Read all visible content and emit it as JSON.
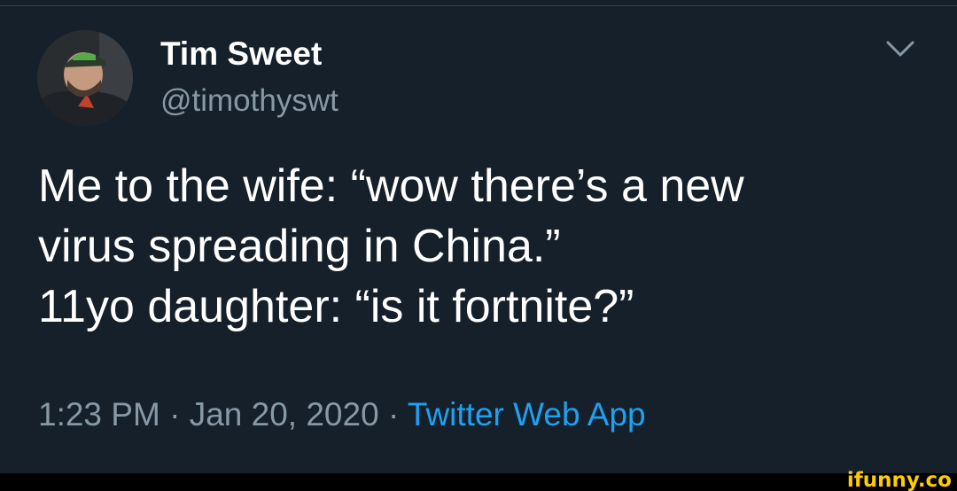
{
  "user": {
    "display_name": "Tim Sweet",
    "handle": "@timothyswt"
  },
  "tweet": {
    "lines": [
      "Me to the wife: “wow there’s a new",
      "virus spreading in China.”",
      "11yo daughter: “is it fortnite?”"
    ],
    "time": "1:23 PM",
    "separator": "·",
    "date": "Jan 20, 2020",
    "source": "Twitter Web App"
  },
  "icons": {
    "menu": "chevron-down-icon"
  },
  "watermark": {
    "text": "ifunny.co"
  },
  "colors": {
    "background": "#15202b",
    "text": "#ffffff",
    "secondary_text": "#8899a6",
    "link": "#1da1f2",
    "watermark": "#ffcc00"
  }
}
